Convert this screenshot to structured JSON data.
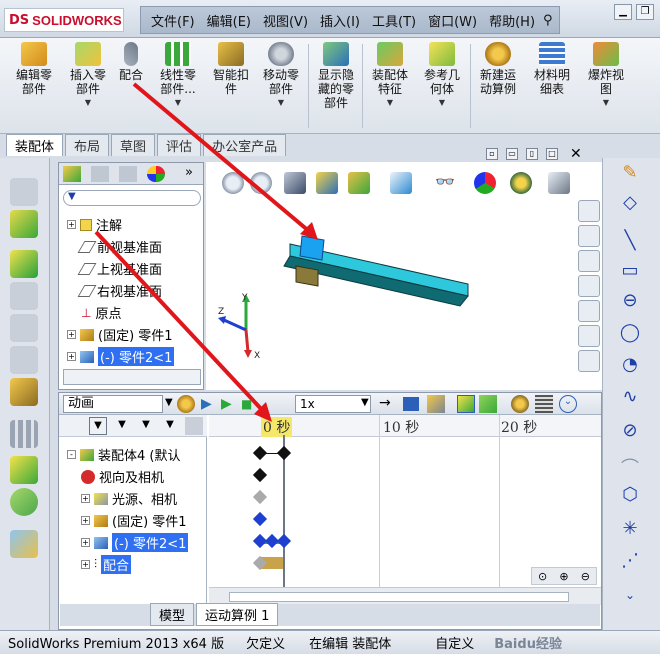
{
  "app": {
    "logo_mark": "DS",
    "logo_text": "SOLIDWORKS"
  },
  "menu": [
    "文件(F)",
    "编辑(E)",
    "视图(V)",
    "插入(I)",
    "工具(T)",
    "窗口(W)",
    "帮助(H)"
  ],
  "toolbar": [
    {
      "label": "编辑零\n部件",
      "icon": "edit-component-icon"
    },
    {
      "label": "插入零\n部件",
      "icon": "insert-component-icon"
    },
    {
      "label": "配合",
      "icon": "mate-icon"
    },
    {
      "label": "线性零\n部件...",
      "icon": "linear-pattern-icon"
    },
    {
      "label": "智能扣\n件",
      "icon": "smart-fastener-icon"
    },
    {
      "label": "移动零\n部件",
      "icon": "move-component-icon"
    },
    {
      "label": "显示隐\n藏的零\n部件",
      "icon": "show-hidden-icon"
    },
    {
      "label": "装配体\n特征",
      "icon": "assembly-feature-icon"
    },
    {
      "label": "参考几\n何体",
      "icon": "reference-geometry-icon"
    },
    {
      "label": "新建运\n动算例",
      "icon": "new-motion-study-icon"
    },
    {
      "label": "材料明\n细表",
      "icon": "bom-icon"
    },
    {
      "label": "爆炸视\n图",
      "icon": "exploded-view-icon"
    }
  ],
  "command_tabs": [
    "装配体",
    "布局",
    "草图",
    "评估",
    "办公室产品"
  ],
  "feature_tree": [
    {
      "label": "注解",
      "expand": "+",
      "icon": "annotation-icon"
    },
    {
      "label": "前视基准面",
      "expand": "",
      "icon": "plane-icon"
    },
    {
      "label": "上视基准面",
      "expand": "",
      "icon": "plane-icon"
    },
    {
      "label": "右视基准面",
      "expand": "",
      "icon": "plane-icon"
    },
    {
      "label": "原点",
      "expand": "",
      "icon": "origin-icon"
    },
    {
      "label": "(固定) 零件1",
      "expand": "+",
      "icon": "part-icon"
    },
    {
      "label": "(-) 零件2<1",
      "expand": "+",
      "icon": "part-icon",
      "selected": true
    }
  ],
  "motion": {
    "study_type": "动画",
    "speed": "1x",
    "time_ticks": [
      "0 秒",
      "10 秒",
      "20 秒"
    ],
    "tree": [
      {
        "label": "装配体4 (默认",
        "expand": "-"
      },
      {
        "label": "视向及相机",
        "expand": ""
      },
      {
        "label": "光源、相机",
        "expand": "+"
      },
      {
        "label": "(固定) 零件1",
        "expand": "+"
      },
      {
        "label": "(-) 零件2<1",
        "expand": "+",
        "selected": true
      },
      {
        "label": "配合",
        "expand": "+",
        "selected": true
      }
    ]
  },
  "bottom_tabs": [
    "模型",
    "运动算例 1"
  ],
  "status": {
    "product": "SolidWorks Premium 2013 x64 版",
    "state1": "欠定义",
    "state2": "在编辑 装配体",
    "custom": "自定义",
    "watermark": "Baidu经验"
  },
  "triad": {
    "y": "Y",
    "z": "Z",
    "x": "X"
  },
  "colors": {
    "accent": "#2f6ff2",
    "part": "#2ec8dc",
    "part_dark": "#0f6a72",
    "arrow": "#e0161b",
    "key_black": "#111111",
    "key_blue": "#1f3fd0"
  }
}
